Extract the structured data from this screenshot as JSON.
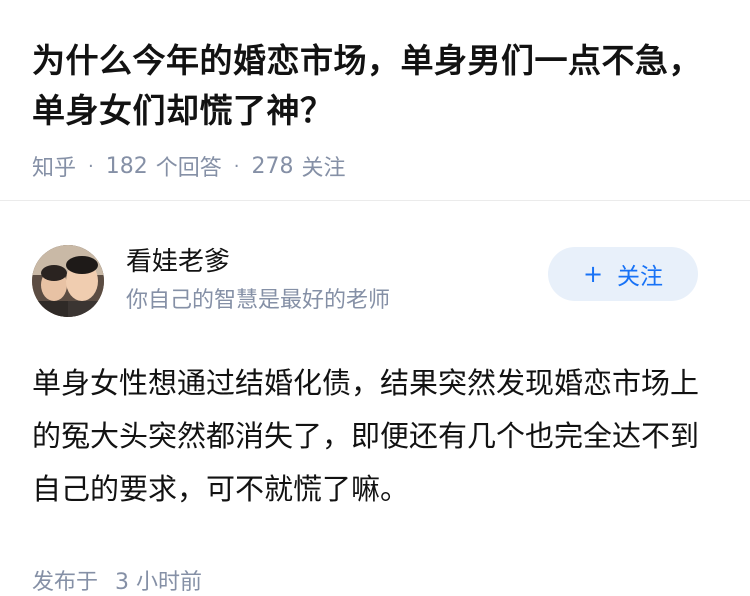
{
  "question": {
    "title": "为什么今年的婚恋市场，单身男们一点不急，单身女们却慌了神？",
    "source": "知乎",
    "answer_count": "182",
    "answer_label": "个回答",
    "follower_count": "278",
    "follower_label": "关注"
  },
  "answer": {
    "author_name": "看娃老爹",
    "author_bio": "你自己的智慧是最好的老师",
    "follow_label": "关注",
    "follow_icon": "plus-icon",
    "content": "单身女性想通过结婚化债，结果突然发现婚恋市场上的冤大头突然都消失了，即便还有几个也完全达不到自己的要求，可不就慌了嘛。",
    "published_label": "发布于",
    "published_time": "3 小时前"
  },
  "colors": {
    "accent": "#1772f6",
    "follow_bg": "#e8f0fa",
    "meta_text": "#8590a6",
    "divider": "#ebebeb"
  }
}
